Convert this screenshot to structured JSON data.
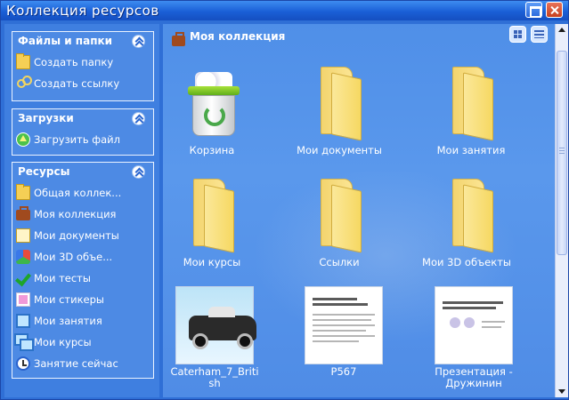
{
  "window": {
    "title": "Коллекция ресурсов"
  },
  "sidebar": {
    "panels": [
      {
        "title": "Файлы и папки",
        "items": [
          {
            "label": "Создать папку",
            "icon": "folder-new-icon"
          },
          {
            "label": "Создать ссылку",
            "icon": "link-icon"
          }
        ]
      },
      {
        "title": "Загрузки",
        "items": [
          {
            "label": "Загрузить файл",
            "icon": "upload-icon"
          }
        ]
      },
      {
        "title": "Ресурсы",
        "items": [
          {
            "label": "Общая коллек...",
            "icon": "shared-folder-icon"
          },
          {
            "label": "Моя коллекция",
            "icon": "briefcase-icon"
          },
          {
            "label": "Мои документы",
            "icon": "documents-icon"
          },
          {
            "label": "Мои 3D объе...",
            "icon": "3d-object-icon"
          },
          {
            "label": "Мои тесты",
            "icon": "checkmark-icon"
          },
          {
            "label": "Мои стикеры",
            "icon": "sticker-icon"
          },
          {
            "label": "Мои занятия",
            "icon": "monitor-icon"
          },
          {
            "label": "Мои курсы",
            "icon": "monitors-icon"
          },
          {
            "label": "Занятие сейчас",
            "icon": "clock-icon"
          }
        ]
      }
    ]
  },
  "content": {
    "breadcrumb": "Моя коллекция",
    "items": [
      {
        "label": "Корзина",
        "type": "recycle-bin"
      },
      {
        "label": "Мои документы",
        "type": "folder"
      },
      {
        "label": "Мои занятия",
        "type": "folder"
      },
      {
        "label": "Мои курсы",
        "type": "folder"
      },
      {
        "label": "Ссылки",
        "type": "folder"
      },
      {
        "label": "Мои 3D объекты",
        "type": "folder"
      },
      {
        "label": "Caterham_7_British",
        "type": "image"
      },
      {
        "label": "P567",
        "type": "document"
      },
      {
        "label": "Презентация - Дружинин",
        "type": "document"
      }
    ]
  },
  "colors": {
    "titlebar": "#1a5fd6",
    "content_bg": "#4f8fe8",
    "sidebar_bg": "#3f7fe0",
    "folder": "#f6d862"
  }
}
